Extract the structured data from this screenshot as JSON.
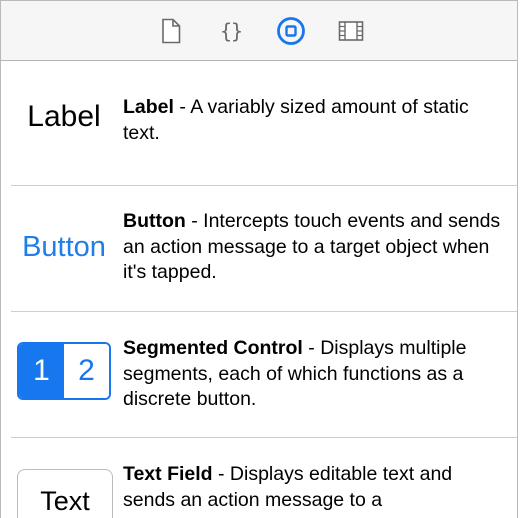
{
  "toolbar": {
    "tabs": [
      {
        "icon": "file-icon",
        "selected": false
      },
      {
        "icon": "braces-icon",
        "glyph": "{}",
        "selected": false
      },
      {
        "icon": "object-library-icon",
        "selected": true
      },
      {
        "icon": "media-library-icon",
        "selected": false
      }
    ],
    "accent_color": "#1677ee"
  },
  "library": {
    "items": [
      {
        "preview": "Label",
        "name": "Label",
        "separator": " - ",
        "description": "A variably sized amount of static text."
      },
      {
        "preview": "Button",
        "name": "Button",
        "separator": " - ",
        "description": "Intercepts touch events and sends an action message to a target object when it's tapped."
      },
      {
        "preview_segments": [
          "1",
          "2"
        ],
        "name": "Segmented Control",
        "separator": " - ",
        "description": "Displays multiple segments, each of which functions as a discrete button."
      },
      {
        "preview": "Text",
        "name": "Text Field",
        "separator": " - ",
        "description": "Displays editable text and sends an action message to a"
      }
    ]
  }
}
